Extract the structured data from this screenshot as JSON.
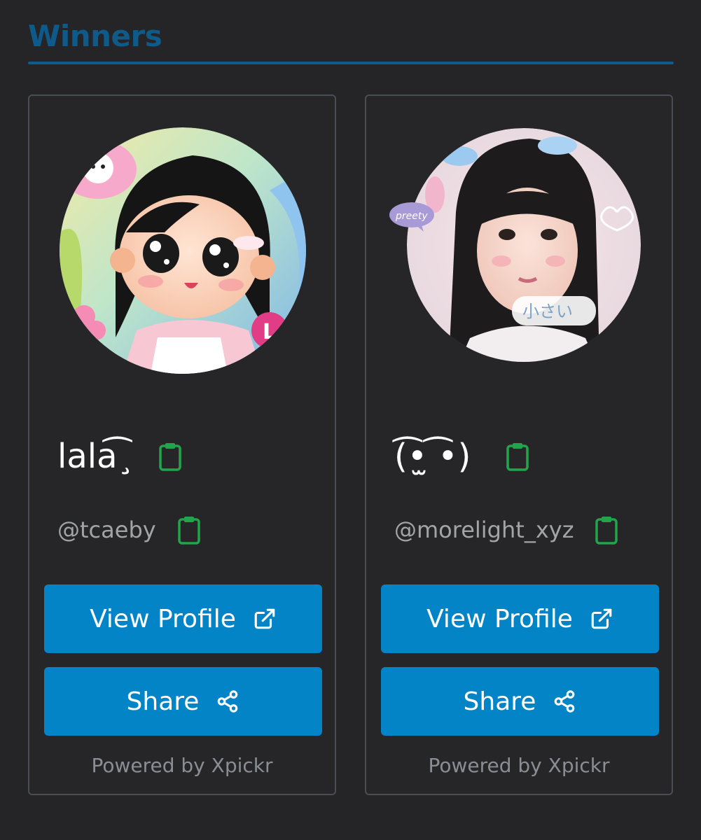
{
  "section": {
    "title": "Winners"
  },
  "winners": [
    {
      "display_name": "lala͡¸",
      "display_name_plain": "lala",
      "handle": "@tcaeby",
      "view_label": "View Profile",
      "share_label": "Share",
      "powered": "Powered by Xpickr",
      "avatar_icon": "cartoon-girl-avatar-icon"
    },
    {
      "display_name": "(͡•̫ ͡•)",
      "handle": "@morelight_xyz",
      "view_label": "View Profile",
      "share_label": "Share",
      "powered": "Powered by Xpickr",
      "avatar_icon": "photo-girl-avatar-icon"
    }
  ],
  "colors": {
    "background": "#252527",
    "title": "#0e5a8a",
    "button": "#0284c7",
    "clipboard": "#22a54a",
    "muted": "#8a8d93"
  }
}
